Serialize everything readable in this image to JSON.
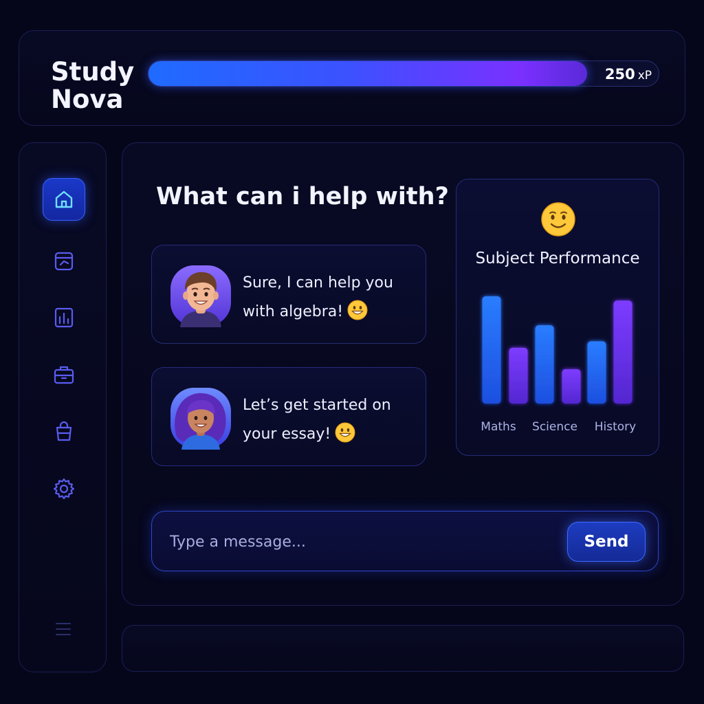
{
  "header": {
    "title_line1": "Study",
    "title_line2": "Nova",
    "xp_value": "250",
    "xp_unit": "xP",
    "xp_progress_fraction": 0.86
  },
  "sidebar": {
    "items": [
      {
        "icon": "home-icon",
        "active": true
      },
      {
        "icon": "notebook-icon",
        "active": false
      },
      {
        "icon": "chart-icon",
        "active": false
      },
      {
        "icon": "briefcase-icon",
        "active": false
      },
      {
        "icon": "bag-icon",
        "active": false
      },
      {
        "icon": "gear-icon",
        "active": false
      }
    ],
    "footer_icon": "menu-icon"
  },
  "main": {
    "heading": "What can i help with?",
    "messages": [
      {
        "avatar": "boy-avatar",
        "text": "Sure, I can help you with algebra!",
        "emoji": "grinning-emoji"
      },
      {
        "avatar": "girl-avatar",
        "text": "Let’s get started on your essay!",
        "emoji": "grinning-emoji"
      }
    ],
    "composer": {
      "placeholder": "Type a message...",
      "send_label": "Send"
    }
  },
  "performance": {
    "emoji": "smiling-emoji",
    "title": "Subject Performance"
  },
  "colors": {
    "accent_blue": "#2b6bff",
    "accent_purple": "#7a30ff",
    "background": "#05061a"
  },
  "chart_data": {
    "type": "bar",
    "title": "Subject Performance",
    "categories": [
      "Maths",
      "Science",
      "History"
    ],
    "bars": [
      {
        "value": 100,
        "color": "blue"
      },
      {
        "value": 52,
        "color": "purple"
      },
      {
        "value": 73,
        "color": "blue"
      },
      {
        "value": 32,
        "color": "purple"
      },
      {
        "value": 58,
        "color": "blue"
      },
      {
        "value": 96,
        "color": "purple"
      }
    ],
    "tick_labels": [
      "Maths",
      "Science",
      "History"
    ],
    "grid": false
  }
}
